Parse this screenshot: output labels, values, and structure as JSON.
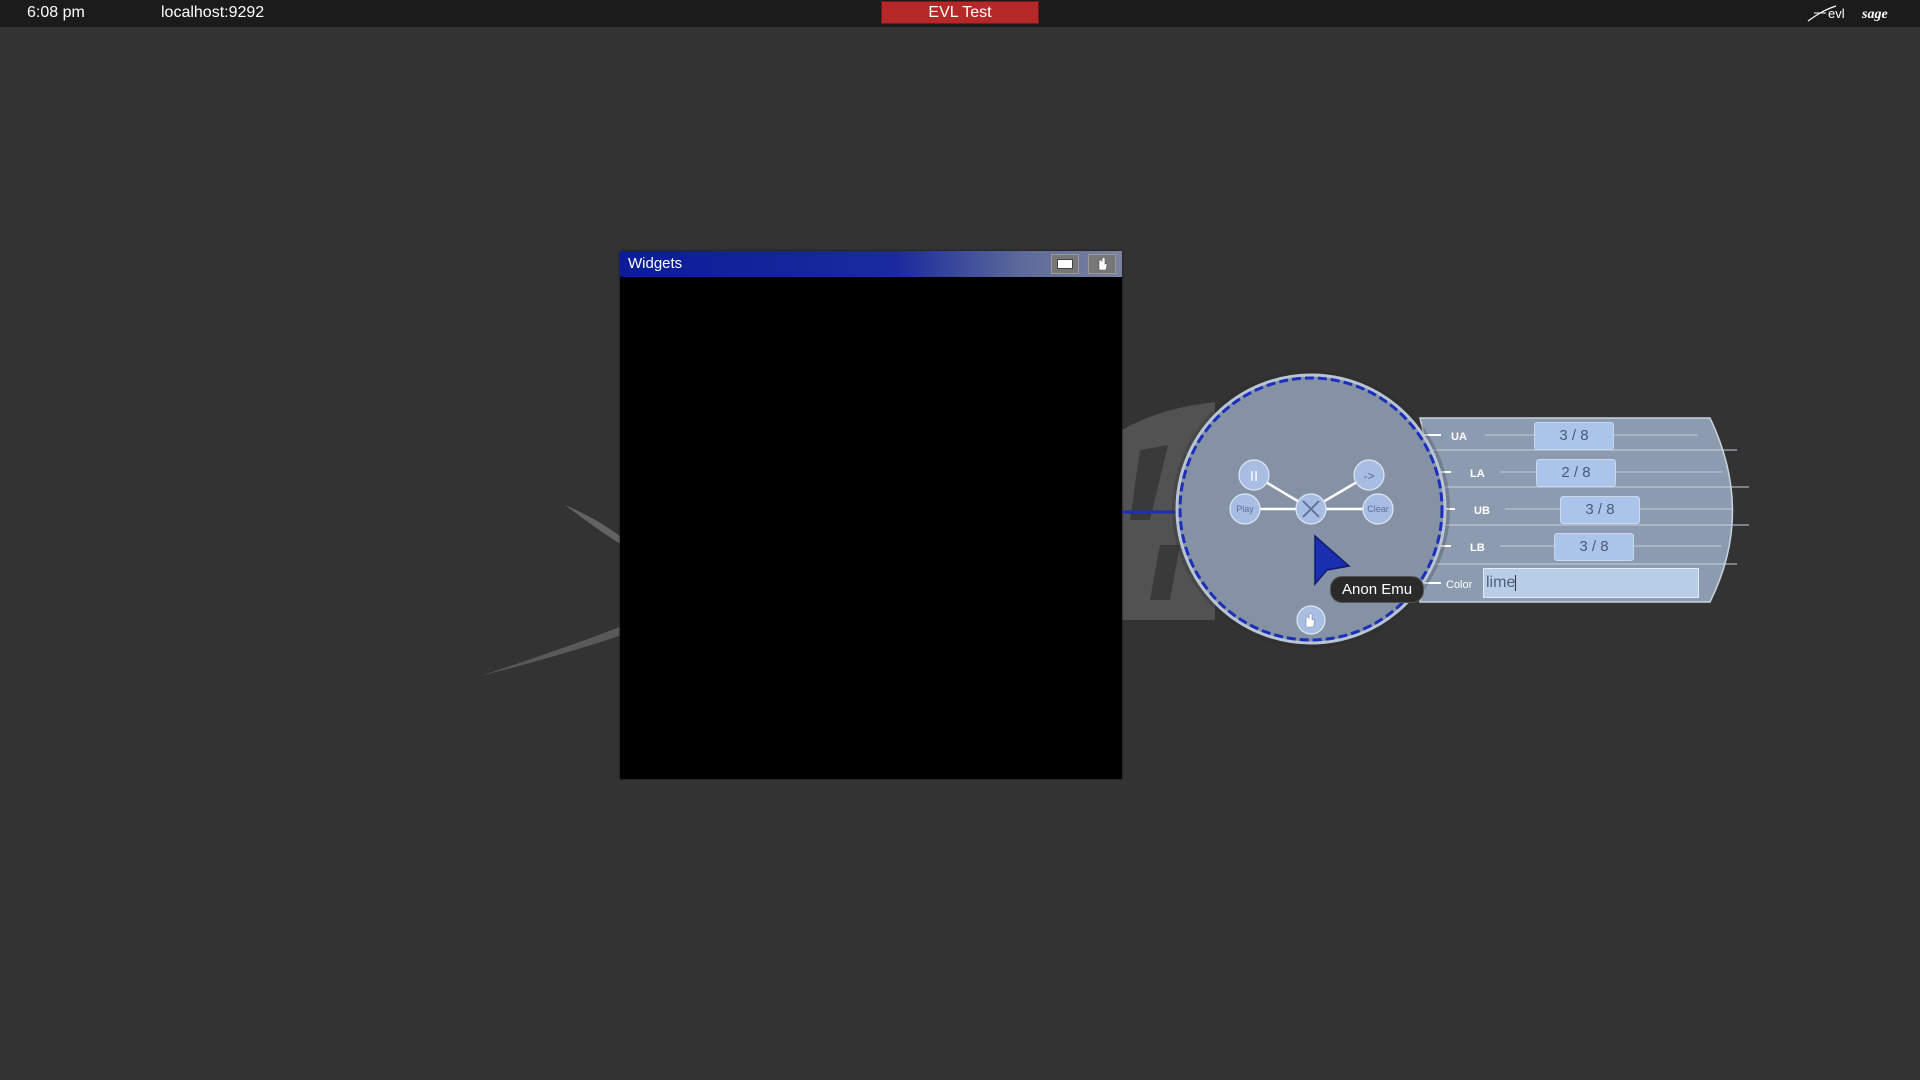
{
  "topbar": {
    "time": "6:08 pm",
    "server": "localhost:9292",
    "session_name": "EVL Test",
    "session_color": "#b52828",
    "logo_evl": "evl",
    "logo_sage": "sage"
  },
  "window": {
    "title": "Widgets",
    "title_color": "#0b1c98",
    "buttons": [
      "maximize-icon",
      "drag-hand-icon"
    ]
  },
  "radial_menu": {
    "buttons": {
      "pause": "II",
      "next": "->",
      "play": "Play",
      "clear": "Clear",
      "close": "close-x-icon",
      "drag": "drag-hand-icon"
    },
    "ring_color": "#1b2fb8"
  },
  "panel": {
    "rows": [
      {
        "label": "UA",
        "value": "3 / 8"
      },
      {
        "label": "LA",
        "value": "2 / 8"
      },
      {
        "label": "UB",
        "value": "3 / 8"
      },
      {
        "label": "LB",
        "value": "3 / 8"
      }
    ],
    "color_label": "Color",
    "color_value": "lime"
  },
  "pointer": {
    "user_name": "Anon Emu",
    "color": "#1a2fb0"
  }
}
